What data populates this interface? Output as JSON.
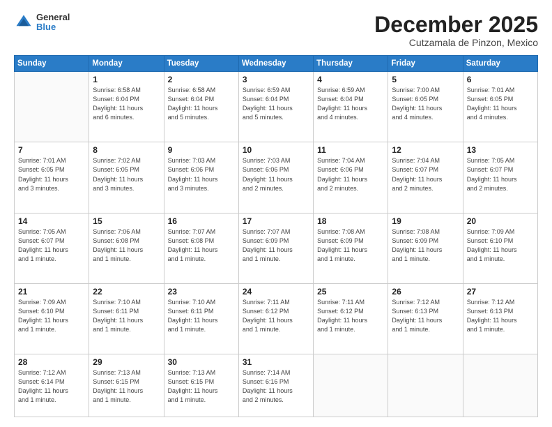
{
  "header": {
    "logo_general": "General",
    "logo_blue": "Blue",
    "month": "December 2025",
    "location": "Cutzamala de Pinzon, Mexico"
  },
  "weekdays": [
    "Sunday",
    "Monday",
    "Tuesday",
    "Wednesday",
    "Thursday",
    "Friday",
    "Saturday"
  ],
  "weeks": [
    [
      {
        "num": "",
        "info": ""
      },
      {
        "num": "1",
        "info": "Sunrise: 6:58 AM\nSunset: 6:04 PM\nDaylight: 11 hours\nand 6 minutes."
      },
      {
        "num": "2",
        "info": "Sunrise: 6:58 AM\nSunset: 6:04 PM\nDaylight: 11 hours\nand 5 minutes."
      },
      {
        "num": "3",
        "info": "Sunrise: 6:59 AM\nSunset: 6:04 PM\nDaylight: 11 hours\nand 5 minutes."
      },
      {
        "num": "4",
        "info": "Sunrise: 6:59 AM\nSunset: 6:04 PM\nDaylight: 11 hours\nand 4 minutes."
      },
      {
        "num": "5",
        "info": "Sunrise: 7:00 AM\nSunset: 6:05 PM\nDaylight: 11 hours\nand 4 minutes."
      },
      {
        "num": "6",
        "info": "Sunrise: 7:01 AM\nSunset: 6:05 PM\nDaylight: 11 hours\nand 4 minutes."
      }
    ],
    [
      {
        "num": "7",
        "info": "Sunrise: 7:01 AM\nSunset: 6:05 PM\nDaylight: 11 hours\nand 3 minutes."
      },
      {
        "num": "8",
        "info": "Sunrise: 7:02 AM\nSunset: 6:05 PM\nDaylight: 11 hours\nand 3 minutes."
      },
      {
        "num": "9",
        "info": "Sunrise: 7:03 AM\nSunset: 6:06 PM\nDaylight: 11 hours\nand 3 minutes."
      },
      {
        "num": "10",
        "info": "Sunrise: 7:03 AM\nSunset: 6:06 PM\nDaylight: 11 hours\nand 2 minutes."
      },
      {
        "num": "11",
        "info": "Sunrise: 7:04 AM\nSunset: 6:06 PM\nDaylight: 11 hours\nand 2 minutes."
      },
      {
        "num": "12",
        "info": "Sunrise: 7:04 AM\nSunset: 6:07 PM\nDaylight: 11 hours\nand 2 minutes."
      },
      {
        "num": "13",
        "info": "Sunrise: 7:05 AM\nSunset: 6:07 PM\nDaylight: 11 hours\nand 2 minutes."
      }
    ],
    [
      {
        "num": "14",
        "info": "Sunrise: 7:05 AM\nSunset: 6:07 PM\nDaylight: 11 hours\nand 1 minute."
      },
      {
        "num": "15",
        "info": "Sunrise: 7:06 AM\nSunset: 6:08 PM\nDaylight: 11 hours\nand 1 minute."
      },
      {
        "num": "16",
        "info": "Sunrise: 7:07 AM\nSunset: 6:08 PM\nDaylight: 11 hours\nand 1 minute."
      },
      {
        "num": "17",
        "info": "Sunrise: 7:07 AM\nSunset: 6:09 PM\nDaylight: 11 hours\nand 1 minute."
      },
      {
        "num": "18",
        "info": "Sunrise: 7:08 AM\nSunset: 6:09 PM\nDaylight: 11 hours\nand 1 minute."
      },
      {
        "num": "19",
        "info": "Sunrise: 7:08 AM\nSunset: 6:09 PM\nDaylight: 11 hours\nand 1 minute."
      },
      {
        "num": "20",
        "info": "Sunrise: 7:09 AM\nSunset: 6:10 PM\nDaylight: 11 hours\nand 1 minute."
      }
    ],
    [
      {
        "num": "21",
        "info": "Sunrise: 7:09 AM\nSunset: 6:10 PM\nDaylight: 11 hours\nand 1 minute."
      },
      {
        "num": "22",
        "info": "Sunrise: 7:10 AM\nSunset: 6:11 PM\nDaylight: 11 hours\nand 1 minute."
      },
      {
        "num": "23",
        "info": "Sunrise: 7:10 AM\nSunset: 6:11 PM\nDaylight: 11 hours\nand 1 minute."
      },
      {
        "num": "24",
        "info": "Sunrise: 7:11 AM\nSunset: 6:12 PM\nDaylight: 11 hours\nand 1 minute."
      },
      {
        "num": "25",
        "info": "Sunrise: 7:11 AM\nSunset: 6:12 PM\nDaylight: 11 hours\nand 1 minute."
      },
      {
        "num": "26",
        "info": "Sunrise: 7:12 AM\nSunset: 6:13 PM\nDaylight: 11 hours\nand 1 minute."
      },
      {
        "num": "27",
        "info": "Sunrise: 7:12 AM\nSunset: 6:13 PM\nDaylight: 11 hours\nand 1 minute."
      }
    ],
    [
      {
        "num": "28",
        "info": "Sunrise: 7:12 AM\nSunset: 6:14 PM\nDaylight: 11 hours\nand 1 minute."
      },
      {
        "num": "29",
        "info": "Sunrise: 7:13 AM\nSunset: 6:15 PM\nDaylight: 11 hours\nand 1 minute."
      },
      {
        "num": "30",
        "info": "Sunrise: 7:13 AM\nSunset: 6:15 PM\nDaylight: 11 hours\nand 1 minute."
      },
      {
        "num": "31",
        "info": "Sunrise: 7:14 AM\nSunset: 6:16 PM\nDaylight: 11 hours\nand 2 minutes."
      },
      {
        "num": "",
        "info": ""
      },
      {
        "num": "",
        "info": ""
      },
      {
        "num": "",
        "info": ""
      }
    ]
  ]
}
